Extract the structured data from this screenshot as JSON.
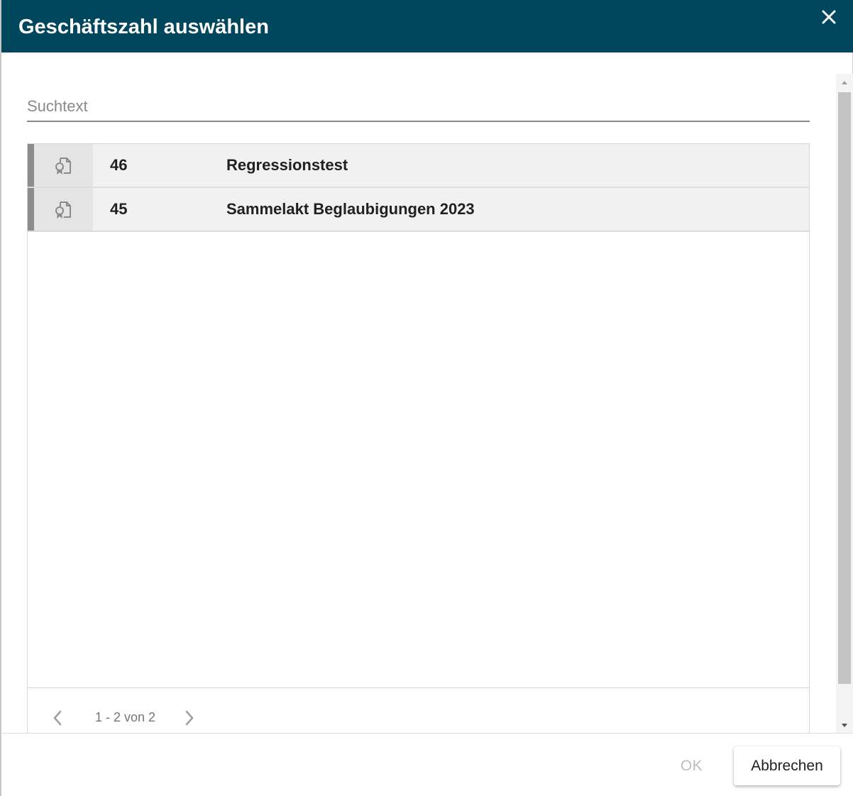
{
  "dialog": {
    "title": "Geschäftszahl auswählen",
    "colors": {
      "header_bg": "#00465d",
      "header_text": "#ffffff",
      "row_bg": "#f1f1f1",
      "row_marker": "#8c8c8c"
    }
  },
  "search": {
    "placeholder": "Suchtext",
    "value": ""
  },
  "list": {
    "rows": [
      {
        "number": "46",
        "name": "Regressionstest",
        "icon": "certificate-document-icon"
      },
      {
        "number": "45",
        "name": "Sammelakt Beglaubigungen 2023",
        "icon": "certificate-document-icon"
      }
    ]
  },
  "pagination": {
    "info": "1 - 2 von 2"
  },
  "footer": {
    "ok_label": "OK",
    "cancel_label": "Abbrechen"
  }
}
